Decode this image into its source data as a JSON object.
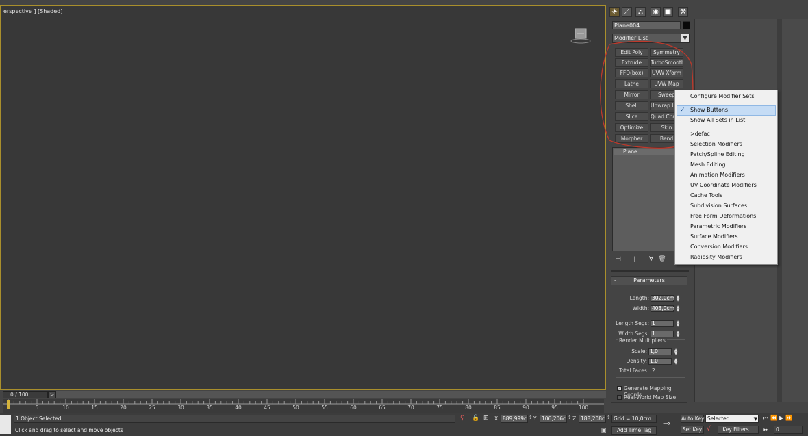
{
  "viewport": {
    "label": "erspective ] [Shaded]"
  },
  "command_panel": {
    "tab_icons": [
      "sun-icon",
      "curve-icon",
      "hierarchy-icon",
      "motion-icon",
      "display-icon",
      "hammer-icon"
    ],
    "object_name": "Plane004",
    "modifier_list": "Modifier List",
    "modifier_buttons": [
      [
        "Edit Poly",
        "Symmetry"
      ],
      [
        "Extrude",
        "TurboSmooth"
      ],
      [
        "FFD(box)",
        "UVW Xform"
      ],
      [
        "Lathe",
        "UVW Map"
      ],
      [
        "Mirror",
        "Sweep"
      ],
      [
        "Shell",
        "Unwrap UVW"
      ],
      [
        "Slice",
        "Quad Chamfer"
      ],
      [
        "Optimize",
        "Skin"
      ],
      [
        "Morpher",
        "Bend"
      ]
    ],
    "stack_item": "Plane",
    "stack_tools": [
      "pin-stack-icon",
      "show-end-result-icon",
      "make-unique-icon",
      "remove-modifier-icon",
      "configure-sets-icon"
    ]
  },
  "parameters": {
    "title": "Parameters",
    "length_label": "Length:",
    "length_value": "302,0cm",
    "width_label": "Width:",
    "width_value": "403,0cm",
    "length_segs_label": "Length Segs:",
    "length_segs_value": "1",
    "width_segs_label": "Width Segs:",
    "width_segs_value": "1",
    "render_group_title": "Render Multipliers",
    "scale_label": "Scale:",
    "scale_value": "1,0",
    "density_label": "Density:",
    "density_value": "1,0",
    "total_faces": "Total Faces : 2",
    "gen_mapping": "Generate Mapping Coords.",
    "real_world": "Real-World Map Size",
    "gen_mapping_checked": true,
    "real_world_checked": false
  },
  "context_menu": {
    "items": [
      "Configure Modifier Sets",
      "Show Buttons",
      "Show All Sets in List",
      ">defac",
      "Selection Modifiers",
      "Patch/Spline Editing",
      "Mesh Editing",
      "Animation Modifiers",
      "UV Coordinate Modifiers",
      "Cache Tools",
      "Subdivision Surfaces",
      "Free Form Deformations",
      "Parametric Modifiers",
      "Surface Modifiers",
      "Conversion Modifiers",
      "Radiosity Modifiers"
    ],
    "checked_item": "Show Buttons",
    "highlight_color": "#c5dcf5"
  },
  "timeline": {
    "slider_text": "0 / 100",
    "next_arrow": ">",
    "ticks": [
      "5",
      "10",
      "15",
      "20",
      "25",
      "30",
      "35",
      "40",
      "45",
      "50",
      "55",
      "60",
      "65",
      "70",
      "75",
      "80",
      "85",
      "90",
      "95",
      "100"
    ]
  },
  "status": {
    "selection": "1 Object Selected",
    "prompt": "Click and drag to select and move objects",
    "x_label": "X:",
    "x_value": "889,999cm",
    "y_label": "Y:",
    "y_value": "106,206cm",
    "z_label": "Z:",
    "z_value": "188,208cm",
    "grid": "Grid = 10,0cm",
    "add_time_tag": "Add Time Tag",
    "auto_key": "Auto Key",
    "set_key": "Set Key",
    "selected_dropdown": "Selected",
    "key_filters": "Key Filters...",
    "frame_value": "0"
  },
  "colors": {
    "viewport_border": "#a98f2c",
    "annotation": "#c0392b"
  }
}
